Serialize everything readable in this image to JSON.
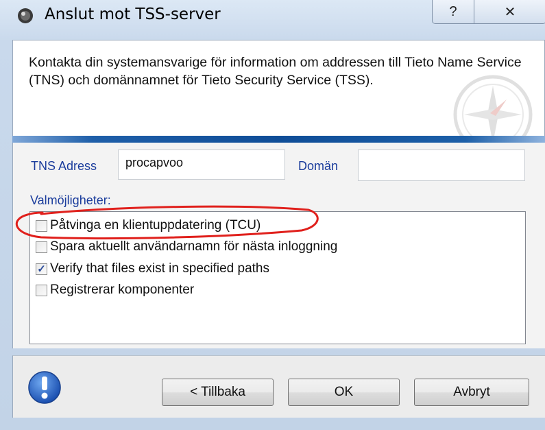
{
  "window": {
    "title": "Anslut mot TSS-server",
    "help_glyph": "?",
    "close_glyph": "✕"
  },
  "banner": {
    "text": "Kontakta din systemansvarige för information om addressen till Tieto Name Service (TNS) och domännamnet för Tieto Security Service (TSS)."
  },
  "form": {
    "tns_label": "TNS Adress",
    "tns_value": "procapvoo",
    "domain_label": "Domän",
    "domain_value": "",
    "options_label": "Valmöjligheter:",
    "options": [
      {
        "label": "Påtvinga en klientuppdatering (TCU)",
        "checked": false
      },
      {
        "label": "Spara aktuellt användarnamn för nästa inloggning",
        "checked": false
      },
      {
        "label": "Verify that files exist in specified paths",
        "checked": true
      },
      {
        "label": "Registrerar komponenter",
        "checked": false
      }
    ]
  },
  "buttons": {
    "back": "< Tillbaka",
    "ok": "OK",
    "cancel": "Avbryt"
  },
  "colors": {
    "label_blue": "#1a3c9c",
    "annotation_red": "#e0201c",
    "banner_strip": "#0f4d97"
  }
}
